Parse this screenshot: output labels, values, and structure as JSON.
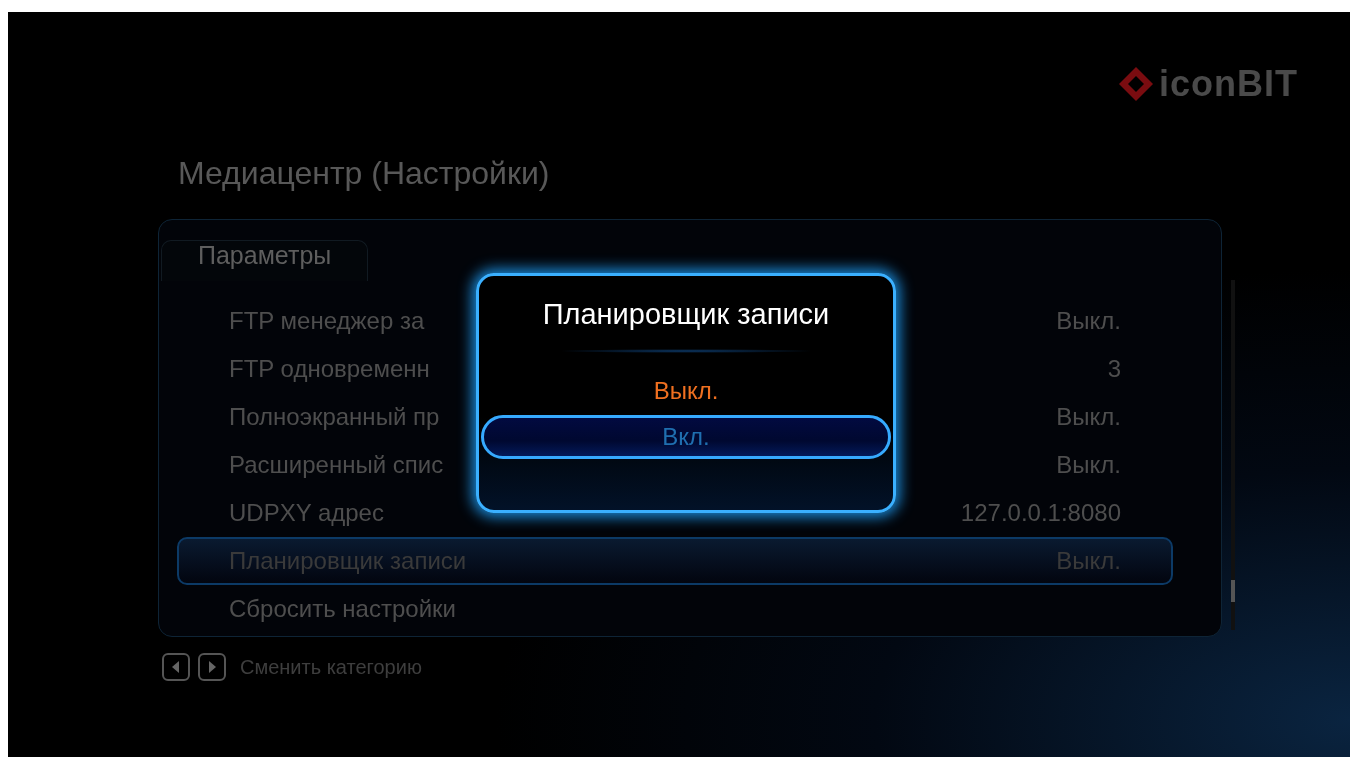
{
  "logo": {
    "text": "iconBIT"
  },
  "title": "Медиацентр (Настройки)",
  "tab": {
    "label": "Параметры",
    "selected": true
  },
  "settings": [
    {
      "label": "FTP менеджер за",
      "value": "Выкл.",
      "selected": false
    },
    {
      "label": "FTP одновременн",
      "value": "3",
      "selected": false
    },
    {
      "label": "Полноэкранный пр",
      "value": "Выкл.",
      "selected": false
    },
    {
      "label": "Расширенный спис",
      "value": "Выкл.",
      "selected": false
    },
    {
      "label": "UDPXY адрес",
      "value": "127.0.0.1:8080",
      "selected": false
    },
    {
      "label": "Планировщик записи",
      "value": "Выкл.",
      "selected": true
    },
    {
      "label": "Сбросить настройки",
      "selected": false
    }
  ],
  "dialog": {
    "title": "Планировщик записи",
    "options": [
      {
        "label": "Выкл.",
        "current": true,
        "selected": false
      },
      {
        "label": "Вкл.",
        "current": false,
        "selected": true
      }
    ]
  },
  "footer": {
    "hint": "Сменить категорию"
  }
}
